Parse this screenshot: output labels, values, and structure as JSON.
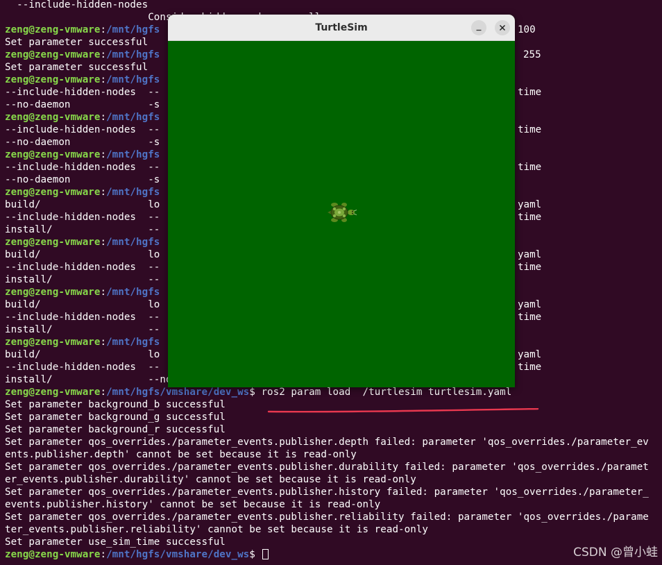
{
  "terminal": {
    "lines": [
      {
        "text": "  --include-hidden-nodes"
      },
      {
        "text": "                        Consider hidden nodes as well"
      },
      {
        "user": "zeng@zeng-vmware",
        "path": "/mnt/hgfs",
        "right": "100"
      },
      {
        "text": "Set parameter successful"
      },
      {
        "user": "zeng@zeng-vmware",
        "path": "/mnt/hgfs",
        "right": "255"
      },
      {
        "text": "Set parameter successful"
      },
      {
        "user": "zeng@zeng-vmware",
        "path": "/mnt/hgfs"
      },
      {
        "text": "--include-hidden-nodes  --",
        "right": "time"
      },
      {
        "text": "--no-daemon             -s"
      },
      {
        "user": "zeng@zeng-vmware",
        "path": "/mnt/hgfs"
      },
      {
        "text": "--include-hidden-nodes  --",
        "right": "time"
      },
      {
        "text": "--no-daemon             -s"
      },
      {
        "user": "zeng@zeng-vmware",
        "path": "/mnt/hgfs"
      },
      {
        "text": "--include-hidden-nodes  --",
        "right": "time"
      },
      {
        "text": "--no-daemon             -s"
      },
      {
        "user": "zeng@zeng-vmware",
        "path": "/mnt/hgfs"
      },
      {
        "text": "build/                  lo",
        "right": "yaml"
      },
      {
        "text": "--include-hidden-nodes  --",
        "right": "time"
      },
      {
        "text": "install/                --"
      },
      {
        "user": "zeng@zeng-vmware",
        "path": "/mnt/hgfs"
      },
      {
        "text": "build/                  lo",
        "right": "yaml"
      },
      {
        "text": "--include-hidden-nodes  --",
        "right": "time"
      },
      {
        "text": "install/                --"
      },
      {
        "user": "zeng@zeng-vmware",
        "path": "/mnt/hgfs"
      },
      {
        "text": "build/                  lo",
        "right": "yaml"
      },
      {
        "text": "--include-hidden-nodes  --",
        "right": "time"
      },
      {
        "text": "install/                --"
      },
      {
        "user": "zeng@zeng-vmware",
        "path": "/mnt/hgfs"
      },
      {
        "text": "build/                  lo",
        "right": "yaml"
      },
      {
        "text": "--include-hidden-nodes  --",
        "right": "time"
      },
      {
        "text": "install/                --no-use-wildcard      src/"
      },
      {
        "user": "zeng@zeng-vmware",
        "path": "/mnt/hgfs/vmshare/dev_ws",
        "cmd": "$ ros2 param load  /turtlesim turtlesim.yaml"
      },
      {
        "text": "Set parameter background_b successful"
      },
      {
        "text": "Set parameter background_g successful"
      },
      {
        "text": "Set parameter background_r successful"
      },
      {
        "text": "Set parameter qos_overrides./parameter_events.publisher.depth failed: parameter 'qos_overrides./parameter_ev"
      },
      {
        "text": "ents.publisher.depth' cannot be set because it is read-only"
      },
      {
        "text": "Set parameter qos_overrides./parameter_events.publisher.durability failed: parameter 'qos_overrides./paramet"
      },
      {
        "text": "er_events.publisher.durability' cannot be set because it is read-only"
      },
      {
        "text": "Set parameter qos_overrides./parameter_events.publisher.history failed: parameter 'qos_overrides./parameter_"
      },
      {
        "text": "events.publisher.history' cannot be set because it is read-only"
      },
      {
        "text": "Set parameter qos_overrides./parameter_events.publisher.reliability failed: parameter 'qos_overrides./parame"
      },
      {
        "text": "ter_events.publisher.reliability' cannot be set because it is read-only"
      },
      {
        "text": "Set parameter use_sim_time successful"
      },
      {
        "user": "zeng@zeng-vmware",
        "path": "/mnt/hgfs/vmshare/dev_ws",
        "cmd": "$ ",
        "cursor": true
      }
    ]
  },
  "annotation_color": "#e8384f",
  "watermark": "CSDN @曾小蛙",
  "turtlesim": {
    "title": "TurtleSim",
    "background_color": "#006400",
    "minimize_icon": "minimize-icon",
    "close_icon": "close-icon",
    "turtle_icon": "turtle-icon"
  }
}
